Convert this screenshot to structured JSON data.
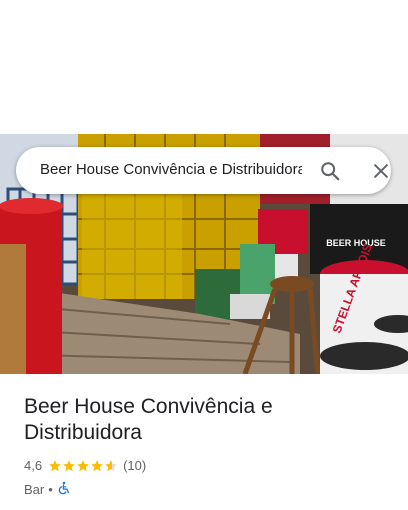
{
  "search": {
    "query": "Beer House Convivência e Distribuidora"
  },
  "place": {
    "name": "Beer House Convivência e Distribuidora",
    "rating": "4,6",
    "rating_value": 4.6,
    "review_count": "(10)",
    "category": "Bar",
    "separator": "•",
    "accessibility_icon": "wheelchair-accessible-icon"
  },
  "photo": {
    "sign_text": "BEER HOUSE",
    "banner_text": "STELLA ARTOIS"
  },
  "colors": {
    "star": "#fbbc04",
    "accessibility": "#1a73e8",
    "text_primary": "#202124",
    "text_secondary": "#5f6368"
  }
}
